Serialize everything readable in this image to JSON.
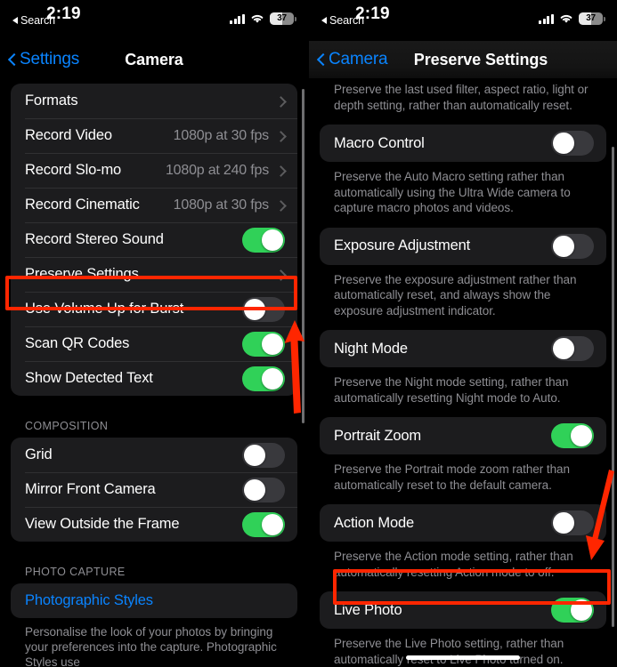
{
  "status_bar": {
    "time": "2:19",
    "back_label": "Search",
    "battery_level": "37",
    "cellular_icon": "signal-bars-icon",
    "wifi_icon": "wifi-icon",
    "battery_icon": "battery-icon"
  },
  "left_panel": {
    "nav": {
      "back_label": "Settings",
      "title": "Camera",
      "back_icon": "chevron-left-icon"
    },
    "group1": [
      {
        "label": "Formats",
        "type": "disclosure",
        "value": ""
      },
      {
        "label": "Record Video",
        "type": "disclosure",
        "value": "1080p at 30 fps"
      },
      {
        "label": "Record Slo-mo",
        "type": "disclosure",
        "value": "1080p at 240 fps"
      },
      {
        "label": "Record Cinematic",
        "type": "disclosure",
        "value": "1080p at 30 fps"
      },
      {
        "label": "Record Stereo Sound",
        "type": "toggle",
        "on": true
      },
      {
        "label": "Preserve Settings",
        "type": "disclosure",
        "value": "",
        "highlighted": true
      },
      {
        "label": "Use Volume Up for Burst",
        "type": "toggle",
        "on": false
      },
      {
        "label": "Scan QR Codes",
        "type": "toggle",
        "on": true
      },
      {
        "label": "Show Detected Text",
        "type": "toggle",
        "on": true
      }
    ],
    "composition": {
      "header": "COMPOSITION",
      "rows": [
        {
          "label": "Grid",
          "type": "toggle",
          "on": false
        },
        {
          "label": "Mirror Front Camera",
          "type": "toggle",
          "on": false
        },
        {
          "label": "View Outside the Frame",
          "type": "toggle",
          "on": true
        }
      ]
    },
    "photo_capture": {
      "header": "PHOTO CAPTURE",
      "rows": [
        {
          "label": "Photographic Styles",
          "type": "link"
        }
      ],
      "footnote": "Personalise the look of your photos by bringing your preferences into the capture. Photographic Styles use"
    }
  },
  "right_panel": {
    "nav": {
      "back_label": "Camera",
      "title": "Preserve Settings",
      "back_icon": "chevron-left-icon"
    },
    "top_description": "Preserve the last used filter, aspect ratio, light or depth setting, rather than automatically reset.",
    "sections": [
      {
        "label": "Macro Control",
        "on": false,
        "description": "Preserve the Auto Macro setting rather than automatically using the Ultra Wide camera to capture macro photos and videos."
      },
      {
        "label": "Exposure Adjustment",
        "on": false,
        "description": "Preserve the exposure adjustment rather than automatically reset, and always show the exposure adjustment indicator."
      },
      {
        "label": "Night Mode",
        "on": false,
        "description": "Preserve the Night mode setting, rather than automatically resetting Night mode to Auto."
      },
      {
        "label": "Portrait Zoom",
        "on": true,
        "description": "Preserve the Portrait mode zoom rather than automatically reset to the default camera."
      },
      {
        "label": "Action Mode",
        "on": false,
        "description": "Preserve the Action mode setting, rather than automatically resetting Action mode to off."
      },
      {
        "label": "Live Photo",
        "on": true,
        "highlighted": true,
        "description": "Preserve the Live Photo setting, rather than automatically reset to Live Photo turned on."
      }
    ]
  },
  "annotations": {
    "highlight_color": "#ff2600",
    "left_arrow": {
      "icon": "arrow-up-annotation",
      "direction": "up"
    },
    "right_arrow": {
      "icon": "arrow-down-annotation",
      "direction": "down"
    }
  },
  "colors": {
    "toggle_on": "#30d158",
    "toggle_off": "#39393d",
    "accent_blue": "#0a84ff",
    "card": "#1c1c1e",
    "secondary_text": "#8e8e93"
  }
}
